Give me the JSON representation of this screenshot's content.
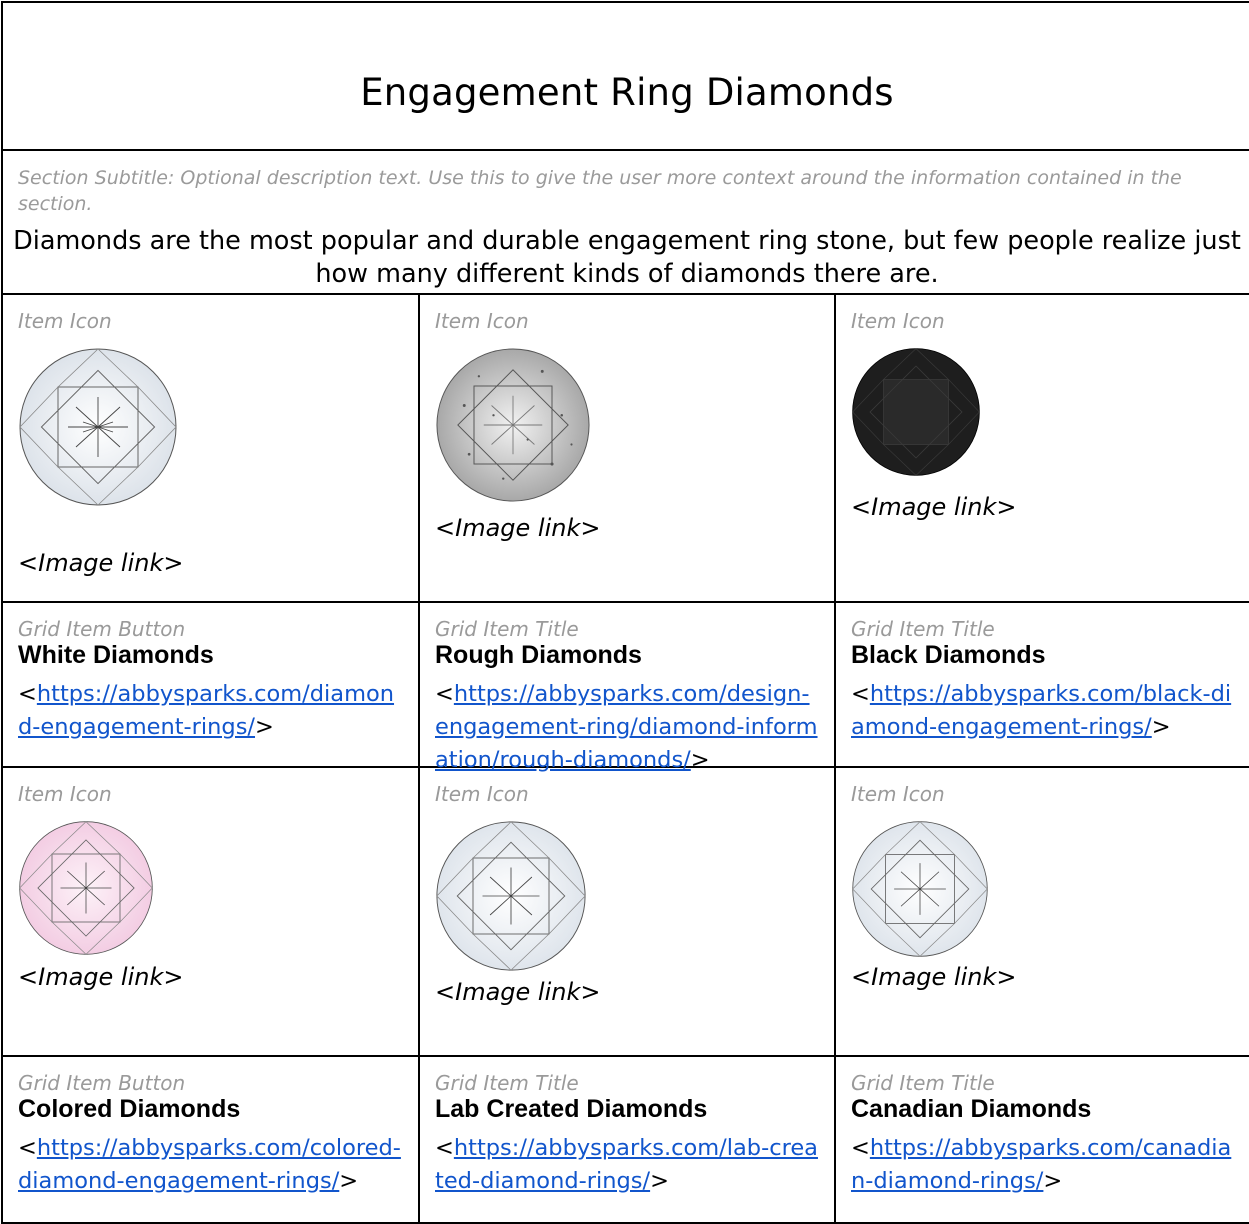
{
  "title": "Engagement Ring Diamonds",
  "subtitle": "Section Subtitle: Optional description text. Use this to give the user more context around the information contained in the section.",
  "intro": "Diamonds are the most popular and durable engagement ring stone, but few people realize just how many different kinds of diamonds there are.",
  "rows": [
    {
      "cells": [
        {
          "label": "Item Icon",
          "link": "<Image link>",
          "gem": "white-diamond"
        },
        {
          "label": "Item Icon",
          "link": "<Image link>",
          "gem": "rough-diamond"
        },
        {
          "label": "Item Icon",
          "link": "<Image link>",
          "gem": "black-diamond"
        }
      ]
    },
    {
      "cells": [
        {
          "label": "Grid Item Button",
          "title": "White Diamonds",
          "url": "https://abbysparks.com/diamond-engagement-rings/"
        },
        {
          "label": "Grid Item Title",
          "title": "Rough Diamonds",
          "url": "https://abbysparks.com/design-engagement-ring/diamond-information/rough-diamonds/"
        },
        {
          "label": "Grid Item Title",
          "title": "Black Diamonds",
          "url": "https://abbysparks.com/black-diamond-engagement-rings/"
        }
      ]
    },
    {
      "cells": [
        {
          "label": "Item Icon",
          "link": "<Image link>",
          "gem": "pink-diamond"
        },
        {
          "label": "Item Icon",
          "link": "<Image link>",
          "gem": "lab-diamond"
        },
        {
          "label": "Item Icon",
          "link": "<Image link>",
          "gem": "canadian-diamond"
        }
      ]
    },
    {
      "cells": [
        {
          "label": "Grid Item Button",
          "title": "Colored Diamonds",
          "url": "https://abbysparks.com/colored-diamond-engagement-rings/"
        },
        {
          "label": "Grid Item Title",
          "title": "Lab Created Diamonds",
          "url": "https://abbysparks.com/lab-created-diamond-rings/"
        },
        {
          "label": "Grid Item Title",
          "title": "Canadian Diamonds",
          "url": "https://abbysparks.com/canadian-diamond-rings/"
        }
      ]
    }
  ],
  "colors": {
    "link": "#1155cc",
    "label": "#9a9a9a",
    "border": "#000000"
  }
}
